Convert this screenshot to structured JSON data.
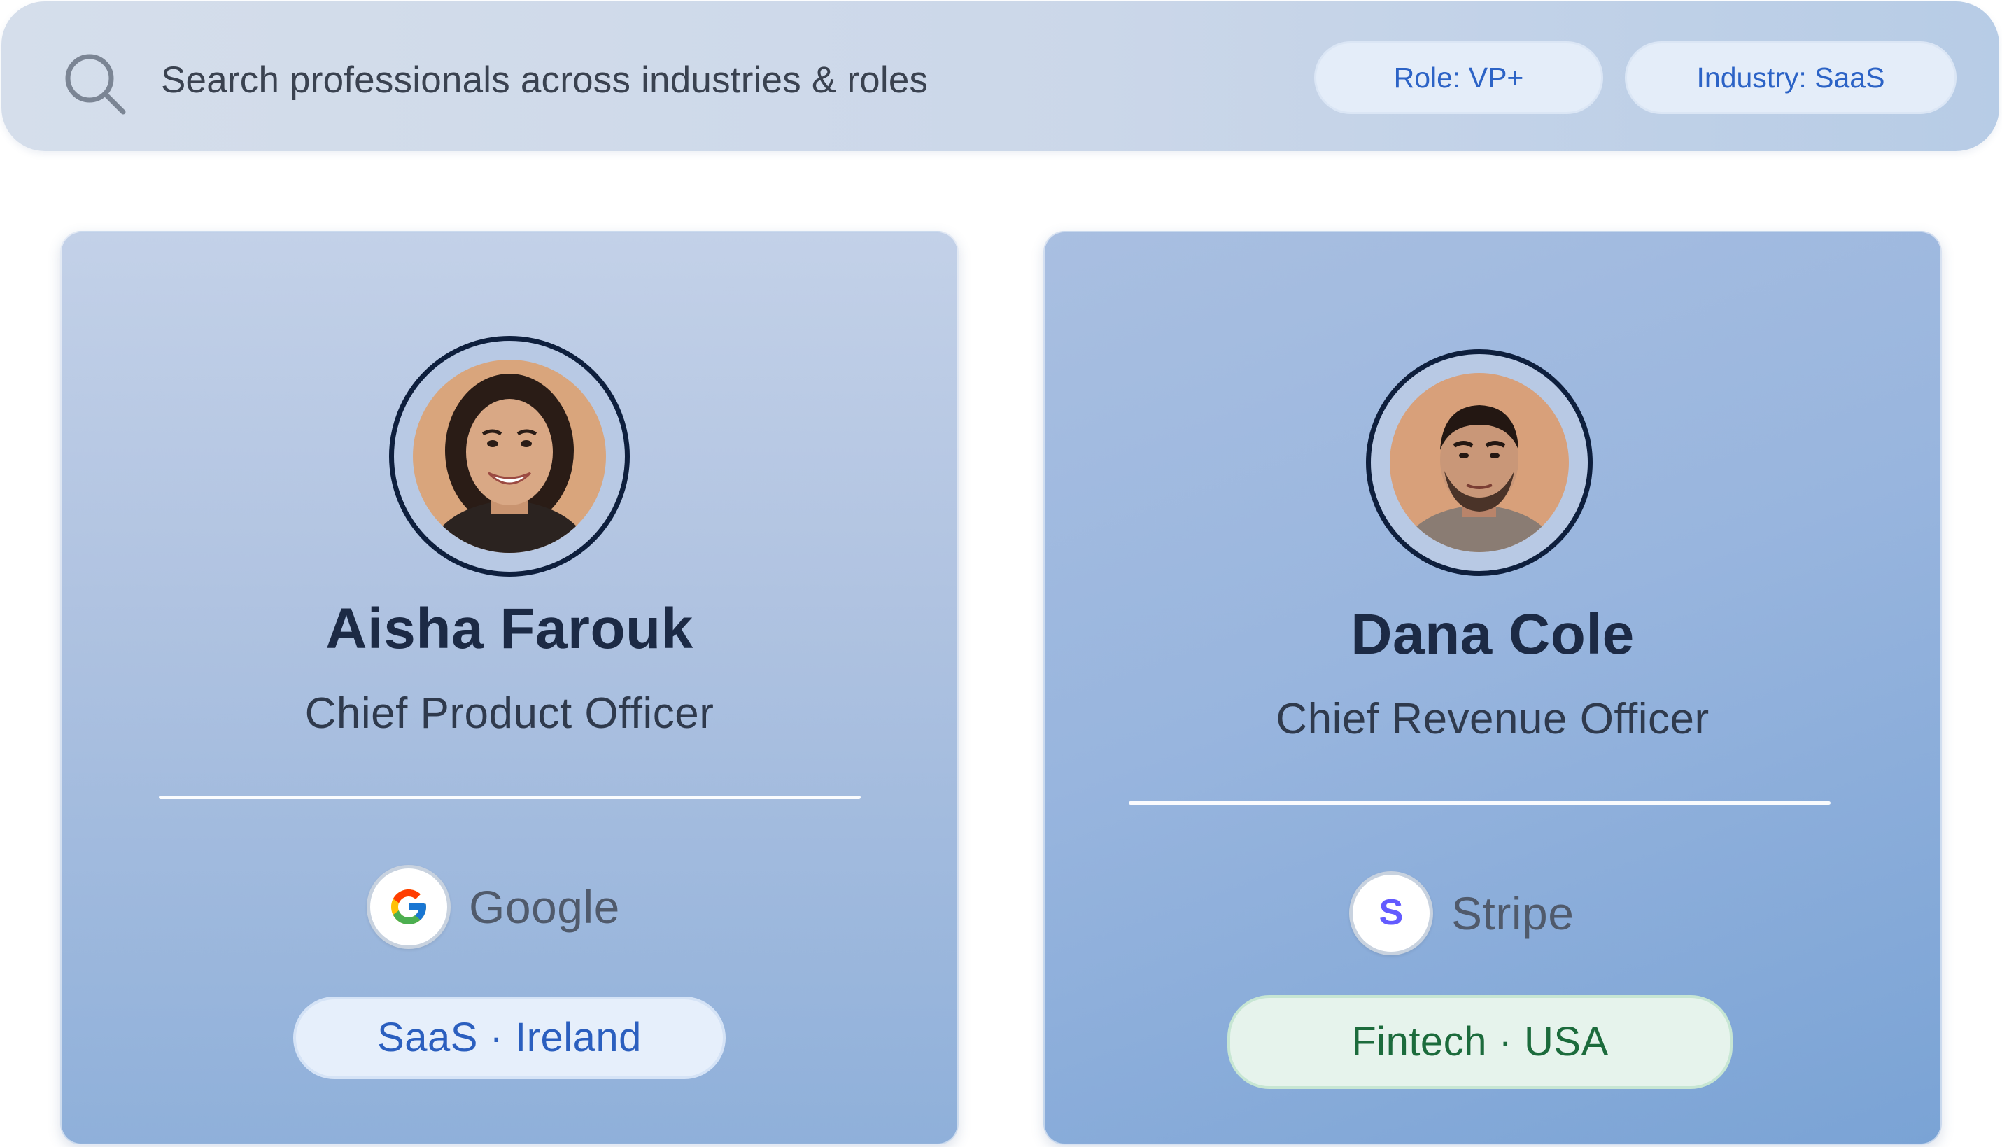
{
  "search": {
    "placeholder": "Search professionals across industries & roles",
    "icon": "search-icon",
    "filters": [
      {
        "label": "Role: VP+"
      },
      {
        "label": "Industry: SaaS"
      }
    ]
  },
  "profiles": [
    {
      "name": "Aisha Farouk",
      "title": "Chief Product Officer",
      "company": {
        "name": "Google",
        "logo": "google-logo"
      },
      "tag": {
        "label": "SaaS · Ireland",
        "color": "#2b5fbf"
      }
    },
    {
      "name": "Dana Cole",
      "title": "Chief Revenue Officer",
      "company": {
        "name": "Stripe",
        "logo": "stripe-logo"
      },
      "tag": {
        "label": "Fintech · USA",
        "color": "#1c6b3c"
      }
    }
  ],
  "colors": {
    "accent_blue": "#2c63c6",
    "avatar_ring": "#0e1f3d",
    "stripe_purple": "#635bff"
  }
}
